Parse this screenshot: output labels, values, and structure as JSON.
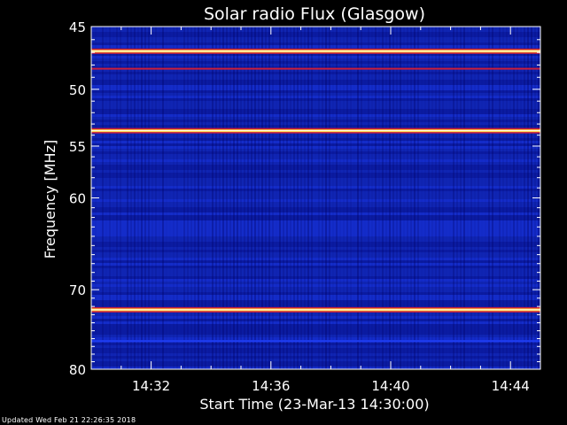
{
  "chart_data": {
    "type": "heatmap",
    "title": "Solar radio Flux (Glasgow)",
    "xlabel": "Start Time (23-Mar-13 14:30:00)",
    "ylabel": "Frequency [MHz]",
    "x_ticks": [
      "14:32",
      "14:36",
      "14:40",
      "14:44"
    ],
    "x_tick_minutes": [
      2,
      6,
      10,
      14
    ],
    "xlim_minutes": [
      0,
      15
    ],
    "y_ticks": [
      45,
      50,
      55,
      60,
      70,
      80
    ],
    "ylim": [
      45,
      80
    ],
    "scale": "log",
    "colors": {
      "background": "#000000",
      "low": "#0a1a9a",
      "mid": "#1e3cf0",
      "high": "#ffd23c",
      "peak": "#ffffff",
      "edge": "#c81e3c"
    },
    "bands": [
      {
        "freq": 46.9,
        "level": "high"
      },
      {
        "freq": 48.3,
        "level": "edge"
      },
      {
        "freq": 53.6,
        "level": "high"
      },
      {
        "freq": 72.4,
        "level": "high"
      },
      {
        "freq": 76.3,
        "level": "low"
      }
    ]
  },
  "footer": "Updated Wed Feb 21 22:26:35 2018"
}
